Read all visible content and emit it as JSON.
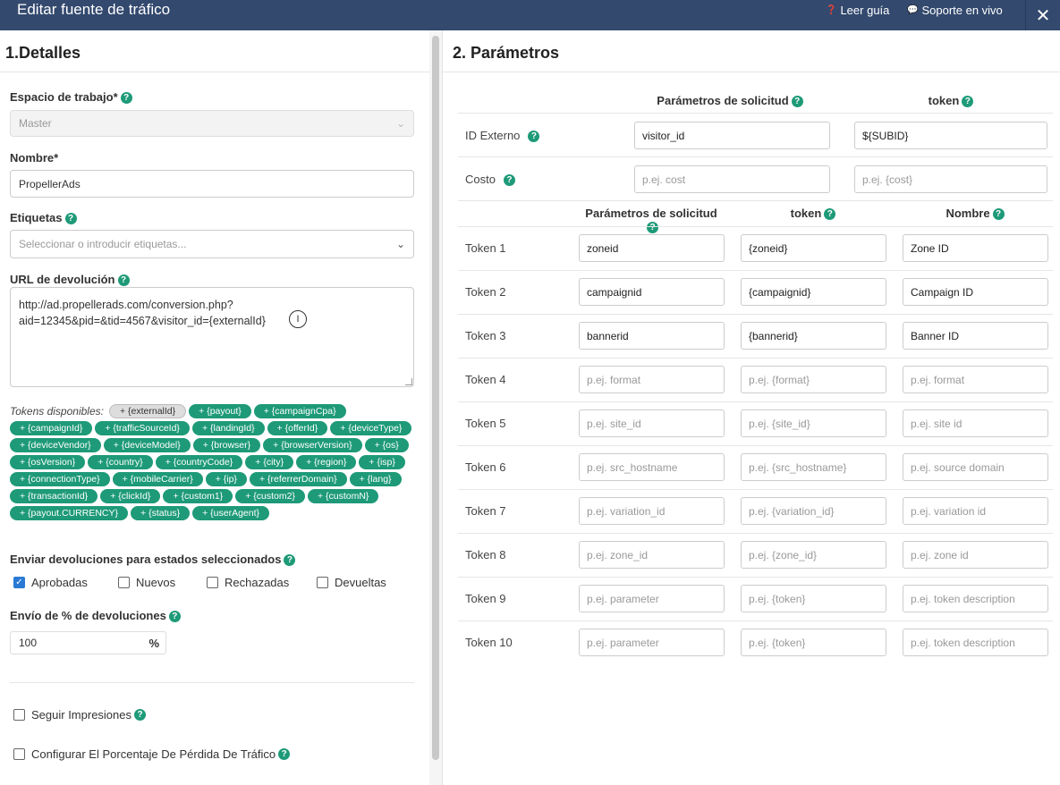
{
  "header": {
    "title": "Editar fuente de tráfico",
    "guide_label": "Leer guía",
    "support_label": "Soporte en vivo",
    "close_glyph": "✕",
    "bg_color": "#33496e"
  },
  "details": {
    "title": "1.Detalles",
    "workspace_label": "Espacio de trabajo*",
    "workspace_value": "Master",
    "name_label": "Nombre*",
    "name_value": "PropellerAds",
    "tags_label": "Etiquetas",
    "tags_placeholder": "Seleccionar o introducir etiquetas...",
    "postback_label": "URL de devolución",
    "postback_line1": "http://ad.propellerads.com/conversion.php?",
    "postback_line2": "aid=12345&pid=&tid=4567&visitor_id={externalId}",
    "tokens_label": "Tokens disponibles:",
    "tokens": [
      "+ {externalId}",
      "+ {payout}",
      "+ {campaignCpa}",
      "+ {campaignId}",
      "+ {trafficSourceId}",
      "+ {landingId}",
      "+ {offerId}",
      "+ {deviceType}",
      "+ {deviceVendor}",
      "+ {deviceModel}",
      "+ {browser}",
      "+ {browserVersion}",
      "+ {os}",
      "+ {osVersion}",
      "+ {country}",
      "+ {countryCode}",
      "+ {city}",
      "+ {region}",
      "+ {isp}",
      "+ {connectionType}",
      "+ {mobileCarrier}",
      "+ {ip}",
      "+ {referrerDomain}",
      "+ {lang}",
      "+ {transactionId}",
      "+ {clickId}",
      "+ {custom1}",
      "+ {custom2}",
      "+ {customN}",
      "+ {payout.CURRENCY}",
      "+ {status}",
      "+ {userAgent}"
    ],
    "status_label": "Enviar devoluciones para estados seleccionados",
    "statuses": [
      {
        "label": "Aprobadas",
        "checked": true
      },
      {
        "label": "Nuevos",
        "checked": false
      },
      {
        "label": "Rechazadas",
        "checked": false
      },
      {
        "label": "Devueltas",
        "checked": false
      }
    ],
    "percent_label": "Envío de % de devoluciones",
    "percent_value": "100",
    "percent_unit": "%",
    "track_impressions_label": "Seguir Impresiones",
    "traffic_loss_label": "Configurar El Porcentaje De Pérdida De Tráfico"
  },
  "params": {
    "title": "2. Parámetros",
    "top_headers": {
      "request": "Parámetros de solicitud",
      "token": "token"
    },
    "top_rows": [
      {
        "label": "ID Externo",
        "request": "visitor_id",
        "request_ph": false,
        "token": "${SUBID}",
        "token_ph": false
      },
      {
        "label": "Costo",
        "request": "p.ej. cost",
        "request_ph": true,
        "token": "p.ej. {cost}",
        "token_ph": true
      }
    ],
    "token_headers": {
      "request": "Parámetros de solicitud",
      "token": "token",
      "name": "Nombre"
    },
    "token_rows": [
      {
        "label": "Token 1",
        "request": "zoneid",
        "token": "{zoneid}",
        "name": "Zone ID",
        "ph": false
      },
      {
        "label": "Token 2",
        "request": "campaignid",
        "token": "{campaignid}",
        "name": "Campaign ID",
        "ph": false
      },
      {
        "label": "Token 3",
        "request": "bannerid",
        "token": "{bannerid}",
        "name": "Banner ID",
        "ph": false
      },
      {
        "label": "Token 4",
        "request": "p.ej. format",
        "token": "p.ej. {format}",
        "name": "p.ej. format",
        "ph": true
      },
      {
        "label": "Token 5",
        "request": "p.ej. site_id",
        "token": "p.ej. {site_id}",
        "name": "p.ej. site id",
        "ph": true
      },
      {
        "label": "Token 6",
        "request": "p.ej. src_hostname",
        "token": "p.ej.  {src_hostname}",
        "name": "p.ej. source domain",
        "ph": true
      },
      {
        "label": "Token 7",
        "request": "p.ej. variation_id",
        "token": "p.ej. {variation_id}",
        "name": "p.ej. variation id",
        "ph": true
      },
      {
        "label": "Token 8",
        "request": "p.ej. zone_id",
        "token": "p.ej. {zone_id}",
        "name": "p.ej. zone id",
        "ph": true
      },
      {
        "label": "Token 9",
        "request": "p.ej. parameter",
        "token": "p.ej. {token}",
        "name": "p.ej. token description",
        "ph": true
      },
      {
        "label": "Token 10",
        "request": "p.ej. parameter",
        "token": "p.ej. {token}",
        "name": "p.ej. token description",
        "ph": true
      }
    ]
  }
}
